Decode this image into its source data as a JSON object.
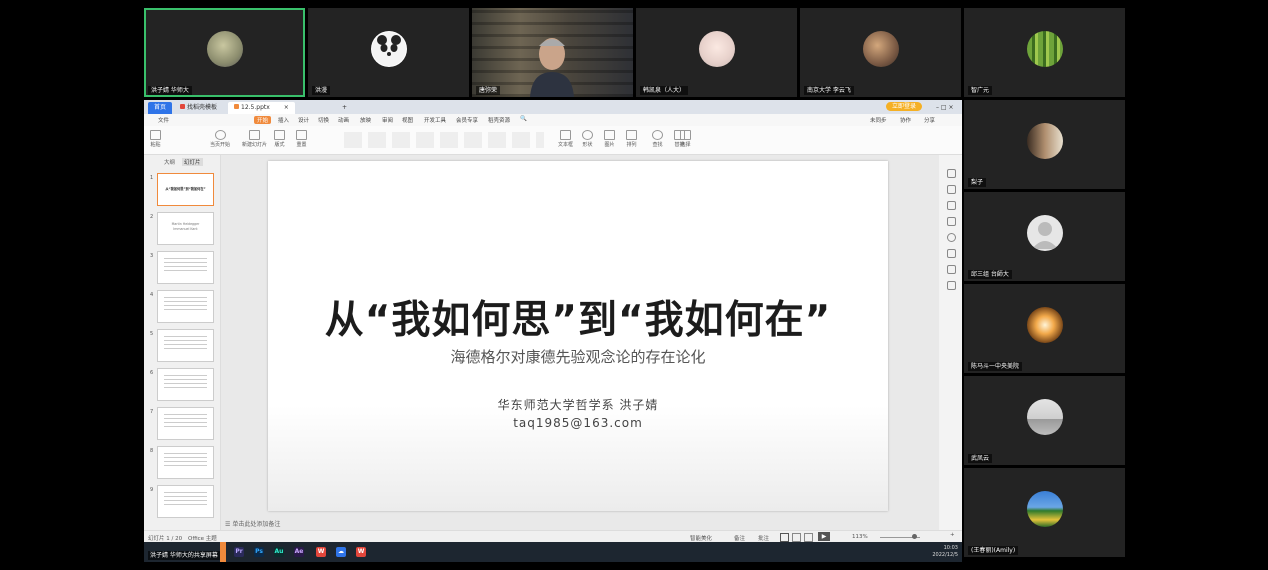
{
  "participants_top": [
    {
      "name": "洪子婧 华师大",
      "avatar": "kiwi-bird",
      "active": true
    },
    {
      "name": "洪漫",
      "avatar": "panda"
    },
    {
      "name": "唐弥荣",
      "avatar": "camera-video"
    },
    {
      "name": "韩凯泉（人大）",
      "avatar": "anime-face"
    },
    {
      "name": "南京大学 李云飞",
      "avatar": "photo"
    },
    {
      "name": "智广元",
      "avatar": "bamboo"
    }
  ],
  "participants_right": [
    {
      "name": "梨子",
      "avatar": "photo"
    },
    {
      "name": "邱三组 台師大",
      "avatar": "default-user"
    },
    {
      "name": "陈马斗一中央美院",
      "avatar": "light"
    },
    {
      "name": "武凤云",
      "avatar": "sky"
    },
    {
      "name": "(王春丽)(Amily)",
      "avatar": "sunflower"
    }
  ],
  "app": {
    "tabs": {
      "home": "首页",
      "template": "找稻壳模板",
      "file": "12.5.pptx"
    },
    "menu": [
      "文件",
      "开始",
      "插入",
      "设计",
      "切换",
      "动画",
      "放映",
      "审阅",
      "视图",
      "开发工具",
      "会员专享",
      "稻壳资源"
    ],
    "menu_right": {
      "unsynced": "未同步",
      "collab": "协作",
      "share": "分享",
      "login": "立即登录"
    },
    "ribbon_buttons": [
      "粘贴",
      "当页开始",
      "新建幻灯片",
      "版式",
      "重置",
      "文本框",
      "形状",
      "图片",
      "排列",
      "查找",
      "替换",
      "选择"
    ],
    "panel_tabs": [
      "大纲",
      "幻灯片"
    ],
    "thumb_count": 9,
    "thumb2_text": [
      "Martin Heidegger",
      "Immanuel Kant"
    ],
    "notes_placeholder": "单击此处添加备注",
    "status_slide": "幻灯片 1 / 20",
    "status_theme": "Office 主题",
    "status_smart": "智能美化",
    "status_notes": "备注",
    "status_comments": "批注",
    "zoom": "113%"
  },
  "slide": {
    "title": "从“我如何思”到“我如何在”",
    "subtitle": "海德格尔对康德先验观念论的存在论化",
    "author": "华东师范大学哲学系  洪子婧",
    "email": "taq1985@163.com"
  },
  "taskbar": {
    "share_label": "洪子婧 华师大的共享屏幕",
    "time": "10:03",
    "date": "2022/12/5",
    "icons": [
      "Pr",
      "Ps",
      "Au",
      "Ae",
      "W",
      "☁",
      "W"
    ]
  },
  "colors": {
    "accent_orange": "#f08a3c",
    "active_green": "#39c06b",
    "tile_bg": "#232323"
  }
}
